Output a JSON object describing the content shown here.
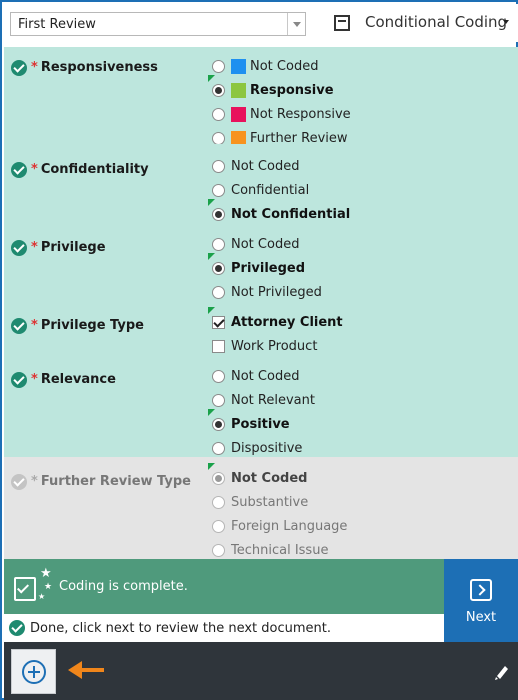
{
  "header": {
    "layout_value": "First Review",
    "coding_title": "Conditional Coding",
    "icons": [
      "document-icon",
      "caret-down-icon"
    ]
  },
  "fields": [
    {
      "name": "Responsiveness",
      "required": "*",
      "status": "complete",
      "choices": [
        {
          "label": "Not Coded",
          "selected": false,
          "color": "#1e90f0"
        },
        {
          "label": "Responsive",
          "selected": true,
          "color": "#8cc63f"
        },
        {
          "label": "Not Responsive",
          "selected": false,
          "color": "#e8125c"
        },
        {
          "label": "Further Review",
          "selected": false,
          "color": "#f7931e"
        }
      ]
    },
    {
      "name": "Confidentiality",
      "required": "*",
      "status": "complete",
      "choices": [
        {
          "label": "Not Coded",
          "selected": false
        },
        {
          "label": "Confidential",
          "selected": false
        },
        {
          "label": "Not Confidential",
          "selected": true
        }
      ]
    },
    {
      "name": "Privilege",
      "required": "*",
      "status": "complete",
      "choices": [
        {
          "label": "Not Coded",
          "selected": false
        },
        {
          "label": "Privileged",
          "selected": true
        },
        {
          "label": "Not Privileged",
          "selected": false
        }
      ]
    },
    {
      "name": "Privilege Type",
      "required": "*",
      "status": "complete",
      "input": "checkbox",
      "choices": [
        {
          "label": "Attorney Client",
          "selected": true
        },
        {
          "label": "Work Product",
          "selected": false
        }
      ]
    },
    {
      "name": "Relevance",
      "required": "*",
      "status": "complete",
      "choices": [
        {
          "label": "Not Coded",
          "selected": false
        },
        {
          "label": "Not Relevant",
          "selected": false
        },
        {
          "label": "Positive",
          "selected": true
        },
        {
          "label": "Dispositive",
          "selected": false
        }
      ]
    },
    {
      "name": "Further Review Type",
      "required": "*",
      "status": "optional",
      "choices": [
        {
          "label": "Not Coded",
          "selected": true
        },
        {
          "label": "Substantive",
          "selected": false
        },
        {
          "label": "Foreign Language",
          "selected": false
        },
        {
          "label": "Technical Issue",
          "selected": false
        }
      ]
    }
  ],
  "status": {
    "message": "Coding is complete.",
    "note": "Done, click next to review the next document."
  },
  "next_button": {
    "label": "Next"
  },
  "toolbar": {
    "icons": [
      "add-icon",
      "arrow-left-icon",
      "pencil-icon"
    ]
  },
  "colors": {
    "accent": "#1d6fb5",
    "complete_bg": "#bde6dd",
    "optional_bg": "#e4e4e4",
    "status_bg": "#4f9a7c",
    "check_green": "#1f8a70",
    "bottom_bar": "#2f353b",
    "indicator_arrow": "#f0861b"
  }
}
